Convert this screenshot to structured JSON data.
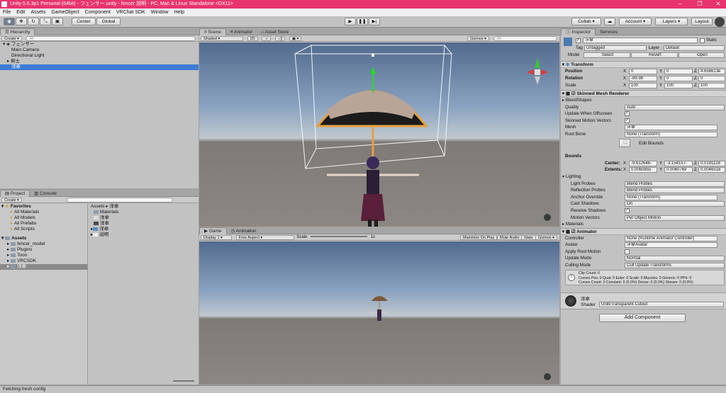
{
  "title_bar": {
    "text": "Unity 5.6.3p1 Personal (64bit) - フェンサー.unity - fencer 説明 - PC, Mac & Linux Standalone <DX11>"
  },
  "menu": [
    "File",
    "Edit",
    "Assets",
    "GameObject",
    "Component",
    "VRChat SDK",
    "Window",
    "Help"
  ],
  "toolbar": {
    "pivot": "Center",
    "space": "Global",
    "collab": "Collab",
    "account": "Account",
    "layers": "Layers",
    "layout": "Layout"
  },
  "hierarchy": {
    "tab": "Hierarchy",
    "create": "Create",
    "search": "All",
    "scene": "フェンサー",
    "items": [
      "Main Camera",
      "Directional Light",
      "剣士",
      "洋傘"
    ]
  },
  "scene_view": {
    "tabs": [
      "Scene",
      "Animator",
      "Asset Store"
    ],
    "shading": "Shaded",
    "mode2d": "2D",
    "gizmos": "Gizmos",
    "search": "All"
  },
  "game_view": {
    "tabs": [
      "Game",
      "Animation"
    ],
    "display": "Display 1",
    "aspect": "Free Aspect",
    "scale_label": "Scale",
    "scale_value": "1x",
    "maximize": "Maximize On Play",
    "mute": "Mute Audio",
    "stats": "Stats",
    "gizmos": "Gizmos"
  },
  "project": {
    "tabs": [
      "Project",
      "Console"
    ],
    "create": "Create",
    "search": "",
    "favorites_label": "Favorites",
    "favorites": [
      "All Materials",
      "All Models",
      "All Prefabs",
      "All Scripts"
    ],
    "assets_label": "Assets",
    "folders": [
      "fencer_model",
      "Plugins",
      "Toon",
      "VRCSDK",
      "洋傘"
    ],
    "breadcrumb": "Assets ▸ 洋傘",
    "files": [
      "Materials",
      "洋傘",
      "洋傘",
      "洋傘",
      "説明"
    ]
  },
  "inspector": {
    "tabs": [
      "Inspector",
      "Services"
    ],
    "object_name": "洋傘",
    "static_label": "Static",
    "tag_label": "Tag",
    "tag_value": "Untagged",
    "layer_label": "Layer",
    "layer_value": "Default",
    "model_label": "Model",
    "model_select": "Select",
    "model_revert": "Revert",
    "model_open": "Open",
    "transform": {
      "header": "Transform",
      "position": {
        "label": "Position",
        "x": "0",
        "y": "0",
        "z": "4.656613e"
      },
      "rotation": {
        "label": "Rotation",
        "x": "-89.98",
        "y": "0",
        "z": "0"
      },
      "scale": {
        "label": "Scale",
        "x": "100",
        "y": "100",
        "z": "100"
      }
    },
    "smr": {
      "header": "Skinned Mesh Renderer",
      "blendshapes": "BlendShapes",
      "quality_label": "Quality",
      "quality": "Auto",
      "update_offscreen": "Update When Offscreen",
      "skinned_motion": "Skinned Motion Vectors",
      "mesh_label": "Mesh",
      "mesh": "洋傘",
      "rootbone_label": "Root Bone",
      "rootbone": "None (Transform)",
      "edit_bounds": "Edit Bounds",
      "bounds_label": "Bounds",
      "center_label": "Center:",
      "center_x": "-9.612646-",
      "center_y": "-3.154157-",
      "center_z": "0.0191128",
      "extents_label": "Extents:",
      "extents_x": "0.0060855",
      "extents_y": "0.0060769",
      "extents_z": "0.0046518",
      "lighting": "Lighting",
      "light_probes_label": "Light Probes",
      "light_probes": "Blend Probes",
      "reflection_probes_label": "Reflection Probes",
      "reflection_probes": "Blend Probes",
      "anchor_label": "Anchor Override",
      "anchor": "None (Transform)",
      "cast_label": "Cast Shadows",
      "cast": "On",
      "receive_label": "Receive Shadows",
      "motion_label": "Motion Vectors",
      "motion": "Per Object Motion",
      "materials": "Materials"
    },
    "animator": {
      "header": "Animator",
      "controller_label": "Controller",
      "controller": "None (Runtime Animator Controller)",
      "avatar_label": "Avatar",
      "avatar": "洋傘Avatar",
      "root_motion_label": "Apply Root Motion",
      "update_label": "Update Mode",
      "update": "Normal",
      "culling_label": "Culling Mode",
      "culling": "Cull Update Transforms",
      "info": [
        "Clip Count: 0",
        "Curves Pos: 0 Quat: 0 Euler: 0 Scale: 0 Muscles: 0 Generic: 0 PPtr: 0",
        "Curves Count: 0 Constant: 0 (0.0%) Dense: 0 (0.0%) Stream: 0 (0.0%)"
      ]
    },
    "material": {
      "name": "洋傘",
      "shader_label": "Shader",
      "shader": "Unlit/Transparent Cutout"
    },
    "add_component": "Add Component"
  },
  "status_bar": {
    "text": "Fetching fresh config"
  }
}
